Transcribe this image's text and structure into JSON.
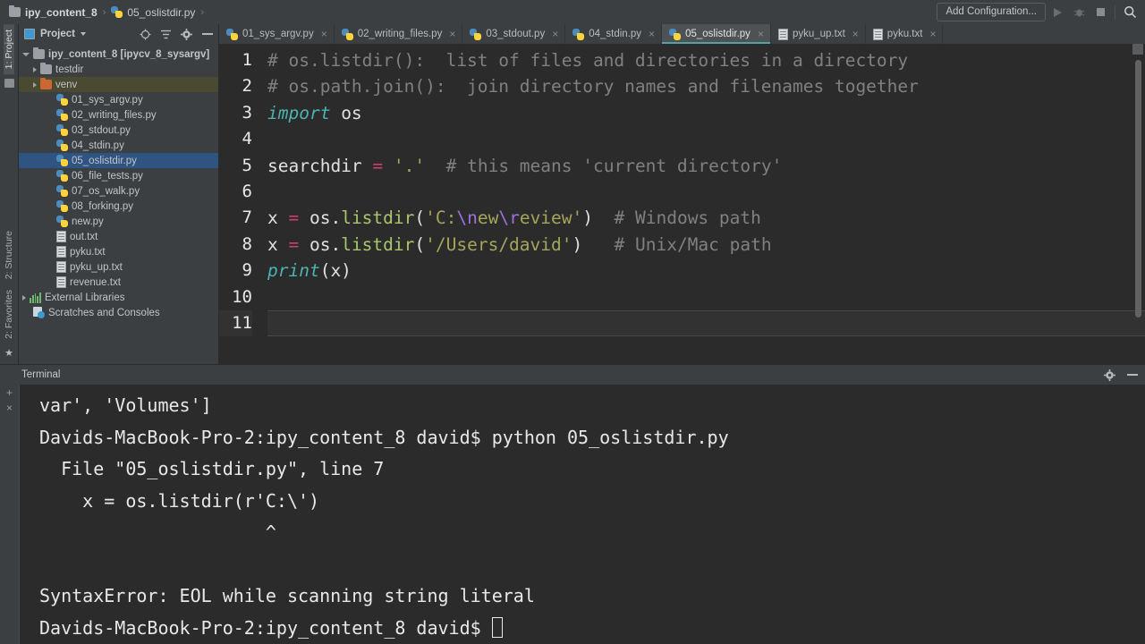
{
  "breadcrumb": {
    "items": [
      {
        "label": "ipy_content_8",
        "icon": "folder-icon",
        "bold": true
      },
      {
        "label": "05_oslistdir.py",
        "icon": "python-file-icon",
        "bold": false
      }
    ],
    "separator": "›"
  },
  "toolbar": {
    "add_configuration": "Add Configuration...",
    "icons": [
      "run-icon",
      "debug-icon",
      "stop-icon",
      "search-icon"
    ]
  },
  "left_strip": {
    "top_label": "1: Project",
    "bottom_labels": [
      "2: Structure",
      "2: Favorites"
    ]
  },
  "project_panel": {
    "title": "Project",
    "header_icons": [
      "target-icon",
      "collapse-all-icon",
      "gear-icon",
      "hide-icon"
    ],
    "tree": [
      {
        "label": "ipy_content_8 [ipycv_8_sysargv]",
        "icon": "folder-icon",
        "indent": 0,
        "arrow": "open",
        "bold": true,
        "state": "normal"
      },
      {
        "label": "testdir",
        "icon": "folder-icon",
        "indent": 1,
        "arrow": "closed",
        "bold": false,
        "state": "normal"
      },
      {
        "label": "venv",
        "icon": "folder-orange-icon",
        "indent": 1,
        "arrow": "closed",
        "bold": false,
        "state": "highlight"
      },
      {
        "label": "01_sys_argv.py",
        "icon": "python-file-icon",
        "indent": 2,
        "arrow": "none",
        "bold": false,
        "state": "normal"
      },
      {
        "label": "02_writing_files.py",
        "icon": "python-file-icon",
        "indent": 2,
        "arrow": "none",
        "bold": false,
        "state": "normal"
      },
      {
        "label": "03_stdout.py",
        "icon": "python-file-icon",
        "indent": 2,
        "arrow": "none",
        "bold": false,
        "state": "normal"
      },
      {
        "label": "04_stdin.py",
        "icon": "python-file-icon",
        "indent": 2,
        "arrow": "none",
        "bold": false,
        "state": "normal"
      },
      {
        "label": "05_oslistdir.py",
        "icon": "python-file-icon",
        "indent": 2,
        "arrow": "none",
        "bold": false,
        "state": "selected"
      },
      {
        "label": "06_file_tests.py",
        "icon": "python-file-icon",
        "indent": 2,
        "arrow": "none",
        "bold": false,
        "state": "normal"
      },
      {
        "label": "07_os_walk.py",
        "icon": "python-file-icon",
        "indent": 2,
        "arrow": "none",
        "bold": false,
        "state": "normal"
      },
      {
        "label": "08_forking.py",
        "icon": "python-file-icon",
        "indent": 2,
        "arrow": "none",
        "bold": false,
        "state": "normal"
      },
      {
        "label": "new.py",
        "icon": "python-file-icon",
        "indent": 2,
        "arrow": "none",
        "bold": false,
        "state": "normal"
      },
      {
        "label": "out.txt",
        "icon": "text-file-icon",
        "indent": 2,
        "arrow": "none",
        "bold": false,
        "state": "normal"
      },
      {
        "label": "pyku.txt",
        "icon": "text-file-icon",
        "indent": 2,
        "arrow": "none",
        "bold": false,
        "state": "normal"
      },
      {
        "label": "pyku_up.txt",
        "icon": "text-file-icon",
        "indent": 2,
        "arrow": "none",
        "bold": false,
        "state": "normal"
      },
      {
        "label": "revenue.txt",
        "icon": "text-file-icon",
        "indent": 2,
        "arrow": "none",
        "bold": false,
        "state": "normal"
      },
      {
        "label": "External Libraries",
        "icon": "library-icon",
        "indent": 0,
        "arrow": "closed",
        "bold": false,
        "state": "normal"
      },
      {
        "label": "Scratches and Consoles",
        "icon": "scratch-icon",
        "indent": 0,
        "arrow": "none",
        "bold": false,
        "state": "normal"
      }
    ]
  },
  "editor": {
    "tabs": [
      {
        "label": "01_sys_argv.py",
        "icon": "python-file-icon",
        "active": false
      },
      {
        "label": "02_writing_files.py",
        "icon": "python-file-icon",
        "active": false
      },
      {
        "label": "03_stdout.py",
        "icon": "python-file-icon",
        "active": false
      },
      {
        "label": "04_stdin.py",
        "icon": "python-file-icon",
        "active": false
      },
      {
        "label": "05_oslistdir.py",
        "icon": "python-file-icon",
        "active": true
      },
      {
        "label": "pyku_up.txt",
        "icon": "text-file-icon",
        "active": false
      },
      {
        "label": "pyku.txt",
        "icon": "text-file-icon",
        "active": false
      }
    ],
    "close_glyph": "×",
    "line_numbers": [
      "1",
      "2",
      "3",
      "4",
      "5",
      "6",
      "7",
      "8",
      "9",
      "10",
      "11"
    ],
    "current_line": 11,
    "lines": [
      {
        "n": "1",
        "tokens": [
          {
            "t": "# os.listdir():  list of files and directories in a directory",
            "c": "c-com"
          }
        ]
      },
      {
        "n": "2",
        "tokens": [
          {
            "t": "# os.path.join():  join directory names and filenames together",
            "c": "c-com"
          }
        ]
      },
      {
        "n": "3",
        "tokens": [
          {
            "t": "import",
            "c": "c-kw"
          },
          {
            "t": " os",
            "c": "c-txt"
          }
        ]
      },
      {
        "n": "4",
        "tokens": []
      },
      {
        "n": "5",
        "tokens": [
          {
            "t": "searchdir ",
            "c": "c-txt"
          },
          {
            "t": "=",
            "c": "c-op"
          },
          {
            "t": " ",
            "c": "c-txt"
          },
          {
            "t": "'.'",
            "c": "c-str"
          },
          {
            "t": "  ",
            "c": "c-txt"
          },
          {
            "t": "# this means 'current directory'",
            "c": "c-com"
          }
        ]
      },
      {
        "n": "6",
        "tokens": []
      },
      {
        "n": "7",
        "tokens": [
          {
            "t": "x ",
            "c": "c-txt"
          },
          {
            "t": "=",
            "c": "c-op"
          },
          {
            "t": " os.",
            "c": "c-txt"
          },
          {
            "t": "listdir",
            "c": "c-fn"
          },
          {
            "t": "(",
            "c": "c-txt"
          },
          {
            "t": "'C:",
            "c": "c-str"
          },
          {
            "t": "\\n",
            "c": "c-esc"
          },
          {
            "t": "ew",
            "c": "c-str"
          },
          {
            "t": "\\r",
            "c": "c-esc"
          },
          {
            "t": "eview'",
            "c": "c-str"
          },
          {
            "t": ")",
            "c": "c-txt"
          },
          {
            "t": "  ",
            "c": "c-txt"
          },
          {
            "t": "# Windows path",
            "c": "c-com"
          }
        ]
      },
      {
        "n": "8",
        "tokens": [
          {
            "t": "x ",
            "c": "c-txt"
          },
          {
            "t": "=",
            "c": "c-op"
          },
          {
            "t": " os.",
            "c": "c-txt"
          },
          {
            "t": "listdir",
            "c": "c-fn"
          },
          {
            "t": "(",
            "c": "c-txt"
          },
          {
            "t": "'/Users/david'",
            "c": "c-str"
          },
          {
            "t": ")",
            "c": "c-txt"
          },
          {
            "t": "   ",
            "c": "c-txt"
          },
          {
            "t": "# Unix/Mac path",
            "c": "c-com"
          }
        ]
      },
      {
        "n": "9",
        "tokens": [
          {
            "t": "print",
            "c": "c-kw"
          },
          {
            "t": "(x)",
            "c": "c-txt"
          }
        ]
      },
      {
        "n": "10",
        "tokens": []
      },
      {
        "n": "11",
        "tokens": []
      }
    ]
  },
  "terminal": {
    "title": "Terminal",
    "gutter_buttons": [
      "+",
      "×"
    ],
    "header_icons": [
      "gear-icon",
      "minimize-icon"
    ],
    "output_lines": [
      "var', 'Volumes']",
      "Davids-MacBook-Pro-2:ipy_content_8 david$ python 05_oslistdir.py",
      "  File \"05_oslistdir.py\", line 7",
      "    x = os.listdir(r'C:\\')",
      "                     ^",
      "",
      "SyntaxError: EOL while scanning string literal"
    ],
    "prompt": "Davids-MacBook-Pro-2:ipy_content_8 david$ "
  },
  "colors": {
    "window_bg": "#3c3f41",
    "editor_bg": "#2b2b2b",
    "accent_tab_underline": "#4ea3a3",
    "selection_blue": "#2f5481",
    "keyword_cyan": "#4cb2b2",
    "function_green": "#a9c66c",
    "string_olive": "#a5a55a",
    "escape_purple": "#a06fd8",
    "operator_pink": "#cc3f6b",
    "comment_gray": "#808080"
  }
}
